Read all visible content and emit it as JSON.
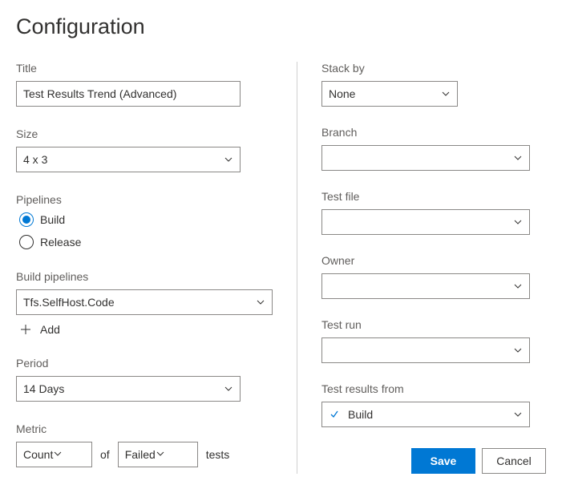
{
  "page": {
    "title": "Configuration"
  },
  "left": {
    "title": {
      "label": "Title",
      "value": "Test Results Trend (Advanced)"
    },
    "size": {
      "label": "Size",
      "value": "4 x 3"
    },
    "pipelines": {
      "label": "Pipelines",
      "options": [
        {
          "label": "Build",
          "selected": true
        },
        {
          "label": "Release",
          "selected": false
        }
      ]
    },
    "buildPipelines": {
      "label": "Build pipelines",
      "value": "Tfs.SelfHost.Code",
      "addLabel": "Add"
    },
    "period": {
      "label": "Period",
      "value": "14 Days"
    },
    "metric": {
      "label": "Metric",
      "first": "Count",
      "of": "of",
      "second": "Failed",
      "suffix": "tests"
    }
  },
  "right": {
    "stackBy": {
      "label": "Stack by",
      "value": "None"
    },
    "branch": {
      "label": "Branch",
      "value": ""
    },
    "testFile": {
      "label": "Test file",
      "value": ""
    },
    "owner": {
      "label": "Owner",
      "value": ""
    },
    "testRun": {
      "label": "Test run",
      "value": ""
    },
    "resultsFrom": {
      "label": "Test results from",
      "value": "Build"
    }
  },
  "buttons": {
    "save": "Save",
    "cancel": "Cancel"
  }
}
